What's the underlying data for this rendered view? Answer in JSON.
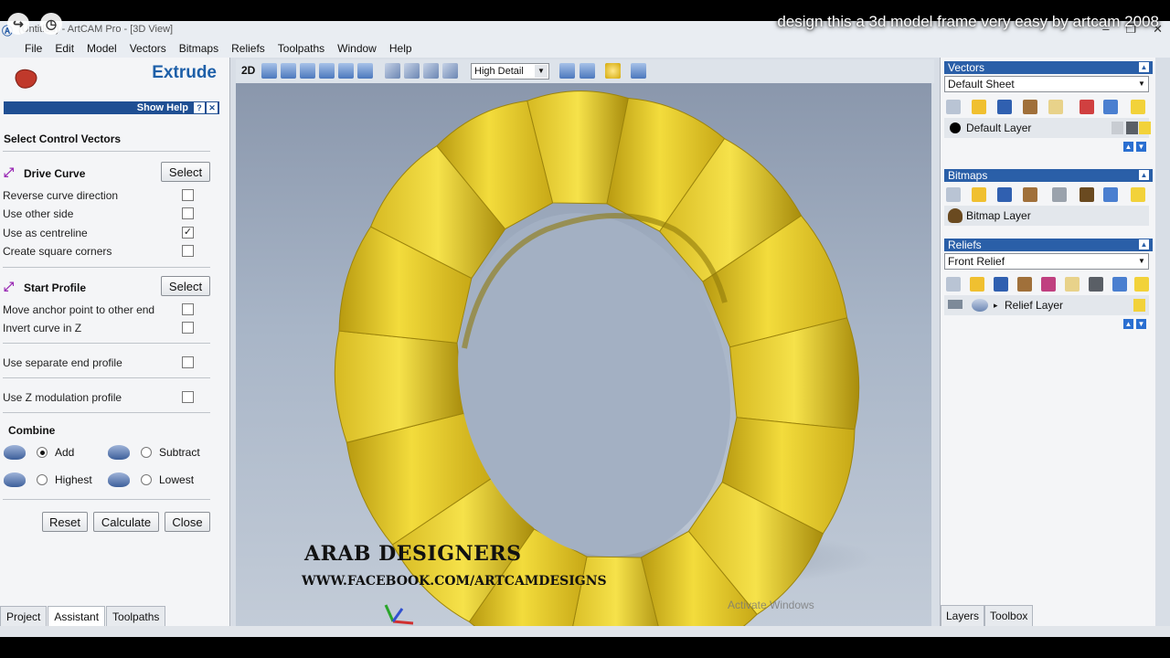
{
  "video": {
    "title": "design this a 3d model frame very easy by artcam 2008"
  },
  "window": {
    "title": "(Untitled) - ArtCAM Pro - [3D View]"
  },
  "menu": [
    "File",
    "Edit",
    "Model",
    "Vectors",
    "Bitmaps",
    "Reliefs",
    "Toolpaths",
    "Window",
    "Help"
  ],
  "left_panel": {
    "title": "Extrude",
    "show_help": "Show Help",
    "section_title": "Select Control Vectors",
    "drive_curve": {
      "label": "Drive Curve",
      "select": "Select",
      "options": [
        {
          "label": "Reverse curve direction",
          "checked": false
        },
        {
          "label": "Use other side",
          "checked": false
        },
        {
          "label": "Use as centreline",
          "checked": true
        },
        {
          "label": "Create square corners",
          "checked": false
        }
      ]
    },
    "start_profile": {
      "label": "Start Profile",
      "select": "Select",
      "options": [
        {
          "label": "Move anchor point to other end",
          "checked": false
        },
        {
          "label": "Invert curve in Z",
          "checked": false
        }
      ]
    },
    "separate_end": {
      "label": "Use separate end profile",
      "checked": false
    },
    "z_modulation": {
      "label": "Use Z modulation profile",
      "checked": false
    },
    "combine": {
      "title": "Combine",
      "add": "Add",
      "subtract": "Subtract",
      "highest": "Highest",
      "lowest": "Lowest",
      "selected": "Add"
    },
    "buttons": {
      "reset": "Reset",
      "calculate": "Calculate",
      "close": "Close"
    },
    "tabs": [
      "Project",
      "Assistant",
      "Toolpaths"
    ]
  },
  "toolbar": {
    "mode": "2D",
    "detail": "High Detail"
  },
  "viewport": {
    "watermark_1": "ARAB DESIGNERS",
    "watermark_2": "WWW.FACEBOOK.COM/ARTCAMDESIGNS",
    "activate": "Activate Windows",
    "relief_color": "#e6c61e"
  },
  "right_panel": {
    "vectors": {
      "title": "Vectors",
      "sheet": "Default Sheet",
      "layer": "Default Layer"
    },
    "bitmaps": {
      "title": "Bitmaps",
      "layer": "Bitmap Layer"
    },
    "reliefs": {
      "title": "Reliefs",
      "relief": "Front Relief",
      "layer": "Relief Layer"
    },
    "tabs": [
      "Layers",
      "Toolbox"
    ]
  }
}
